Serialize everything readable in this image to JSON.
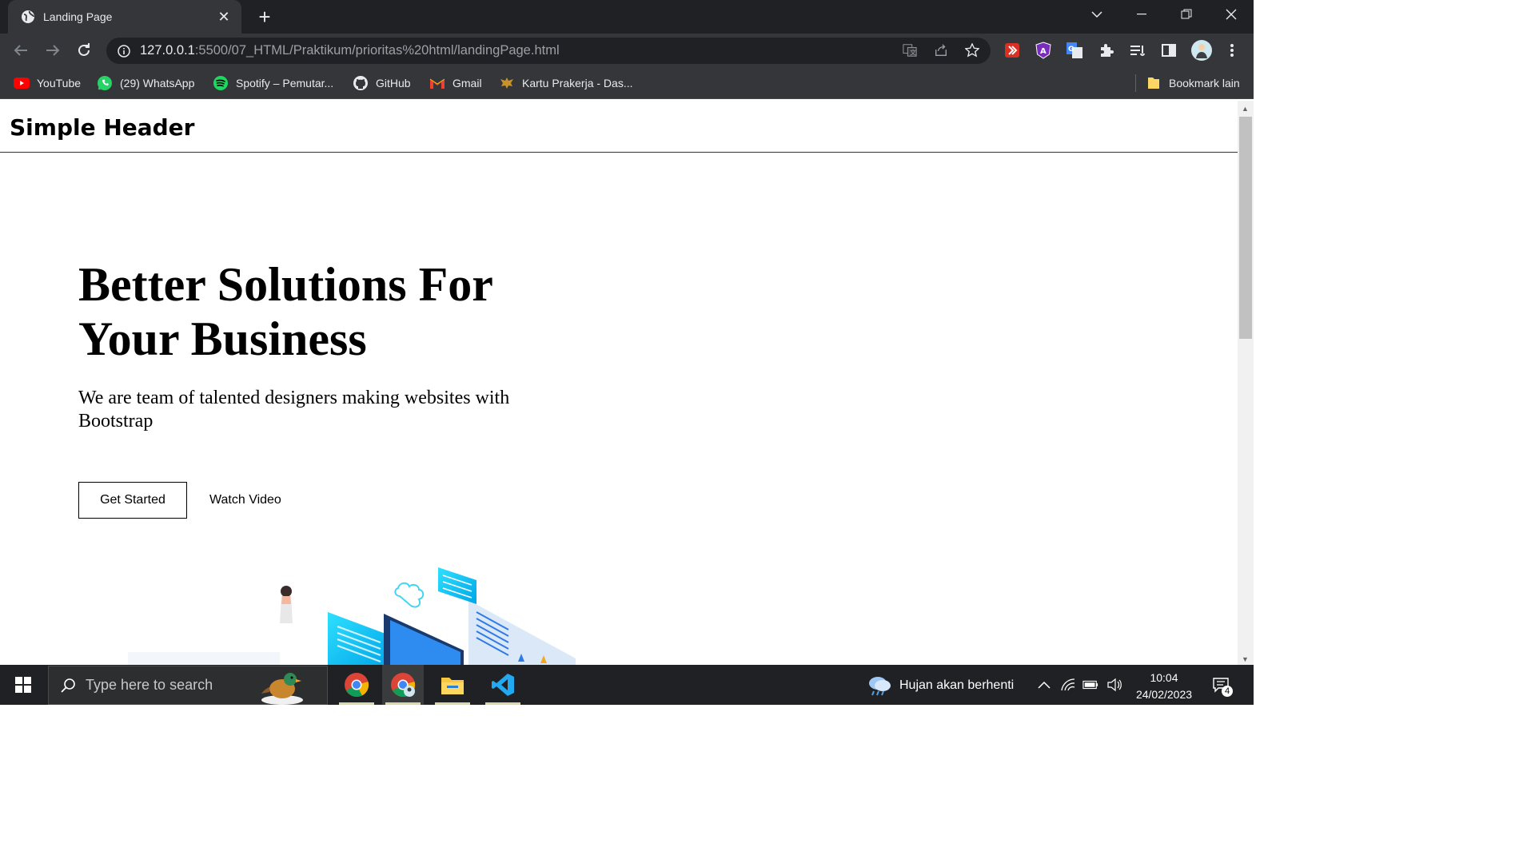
{
  "browser": {
    "tab_title": "Landing Page",
    "url_host": "127.0.0.1",
    "url_rest": ":5500/07_HTML/Praktikum/prioritas%20html/landingPage.html",
    "bookmarks": [
      {
        "label": "YouTube",
        "icon": "youtube-icon"
      },
      {
        "label": "(29) WhatsApp",
        "icon": "whatsapp-icon"
      },
      {
        "label": "Spotify – Pemutar...",
        "icon": "spotify-icon"
      },
      {
        "label": "GitHub",
        "icon": "github-icon"
      },
      {
        "label": "Gmail",
        "icon": "gmail-icon"
      },
      {
        "label": "Kartu Prakerja - Das...",
        "icon": "garuda-icon"
      }
    ],
    "other_bookmarks": "Bookmark lain",
    "colors": {
      "frame": "#202124",
      "toolbar": "#35363a"
    }
  },
  "page": {
    "brand": "Simple Header",
    "hero_title": "Better Solutions For Your Business",
    "hero_subtitle": "We are team of talented designers making websites with Bootstrap",
    "cta_primary": "Get Started",
    "cta_secondary": "Watch Video"
  },
  "taskbar": {
    "search_placeholder": "Type here to search",
    "weather_text": "Hujan akan berhenti",
    "time": "10:04",
    "date": "24/02/2023",
    "notification_count": "4"
  }
}
